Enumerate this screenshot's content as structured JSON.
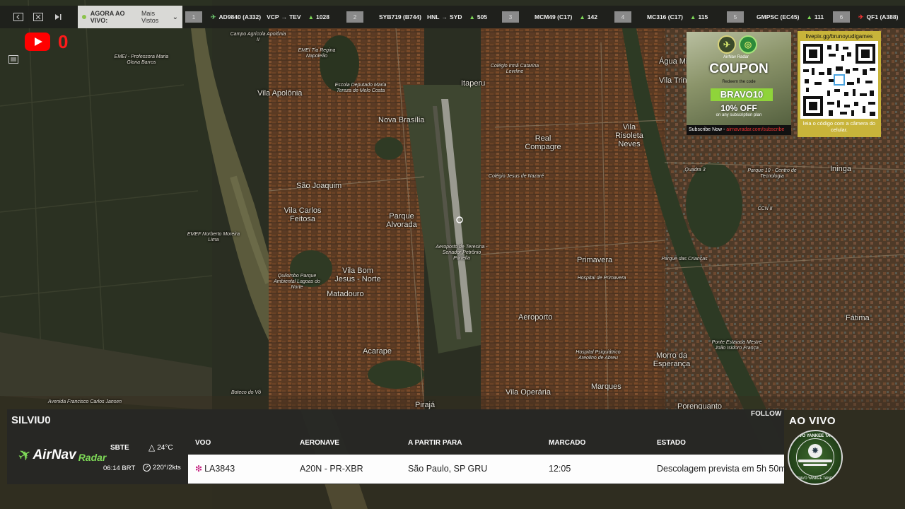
{
  "topbar": {
    "live_label": "AGORA AO VIVO: ",
    "live_value": "Mais Vistos",
    "slots": [
      {
        "num": "1",
        "flight": "AD9840 (A332)",
        "from": "VCP",
        "to": "TEV",
        "alt": "1028",
        "plane_color": "green"
      },
      {
        "num": "2",
        "flight": "SYB719 (B744)",
        "from": "HNL",
        "to": "SYD",
        "alt": "505",
        "plane_color": "none"
      },
      {
        "num": "3",
        "flight": "MCM49 (C17)",
        "from": "",
        "to": "",
        "alt": "142",
        "plane_color": "none"
      },
      {
        "num": "4",
        "flight": "MC316 (C17)",
        "from": "",
        "to": "",
        "alt": "115",
        "plane_color": "none"
      },
      {
        "num": "5",
        "flight": "GMPSC (EC45)",
        "from": "",
        "to": "",
        "alt": "111",
        "plane_color": "none"
      },
      {
        "num": "6",
        "flight": "QF1 (A388)",
        "from": "",
        "to": "",
        "alt": "",
        "plane_color": "red"
      }
    ]
  },
  "youtube": {
    "count": "0"
  },
  "map_labels": {
    "vila_apolonia": "Vila Apolônia",
    "nova_brasilia": "Nova Brasília",
    "itaperu": "Itaperu",
    "vila_trindade": "Vila Trindade",
    "vila_risoleta": "Vila Risoleta Neves",
    "real_compagre": "Real Compagre",
    "sao_joaquim": "São Joaquim",
    "vila_carlos_feitosa": "Vila Carlos Feitosa",
    "parque_alvorada": "Parque Alvorada",
    "vila_bom_jesus": "Vila Bom Jesus - Norte",
    "matadouro": "Matadouro",
    "acarape": "Acarape",
    "primavera": "Primavera",
    "aeroporto": "Aeroporto",
    "morro_esperanca": "Morro da Esperança",
    "marques": "Marques",
    "vila_operaria": "Vila Operária",
    "piraja": "Pirajá",
    "aguas_mineral": "Água Mineral",
    "fatima": "Fátima",
    "ininga": "Ininga",
    "porenquanto": "Porenquanto",
    "cond_apolonia": "Campo Agrícola Apolônia II",
    "emei_prof": "EMEI - Professora Maria Gloria Barros",
    "emef_norberto": "EMEF Norberto Moreira Lima",
    "emei_tia": "EMEI Tia Regina Napoleão",
    "emef_dep": "Escola Deputado Maria Tereza de Melo Costa",
    "aeroporto_terminal": "Aeroporto de Teresina - Senador Petrônio Portella",
    "colegio": "Colégio Irmã Catarina Levrline",
    "quadra": "Quadra 3",
    "parque10": "Parque 10 - Centro de Tecnologia",
    "cgn": "CCN II",
    "parque_criancas": "Parque das Crianças",
    "ponte": "Ponte Estaiada Mestre João Isidoro França",
    "hospital": "Hospital de Primavera",
    "hospital2": "Hospital Psiquiátrico Areolino de Abreu",
    "quilombo": "Quilombo Parque Ambiental Lagoas do Norte",
    "boteco": "Boteco do Vô",
    "avenida": "Avenida Francisco Carlos Jansen",
    "colegio2": "Colégio Jesus de Nazaré"
  },
  "coupon": {
    "brand": "AirNav Radar",
    "title": "COUPON",
    "sub": "Redeem the code",
    "code": "BRAVO10",
    "discount": "10% OFF",
    "note": "on any subscription plan",
    "footer_left": "Subscribe Now - ",
    "footer_right": "airnavradar.com/subscribe"
  },
  "qr": {
    "url": "livepix.gg/brunoyudigames",
    "caption": "leia o código com a câmera do celular."
  },
  "panel": {
    "callsign": "SILVIU0",
    "follow": "FOLLOW",
    "logo_air": "AirNav",
    "logo_radar": "Radar",
    "airport": "SBTE",
    "time": "06:14 BRT",
    "temp": "24°C",
    "wind": "220°/2kts",
    "headers": {
      "voo": "VOO",
      "aeronave": "AERONAVE",
      "partir": "A PARTIR PARA",
      "marcado": "MARCADO",
      "estado": "ESTADO"
    },
    "row": {
      "voo": "LA3843",
      "aeronave": "A20N - PR-XBR",
      "partir": "São Paulo, SP GRU",
      "marcado": "12:05",
      "estado": "Descolagem prevista em 5h 50m"
    }
  },
  "aovivo": {
    "label": "AO VIVO",
    "badge_top": "BRAVO YANKEE TANGO",
    "badge_bot": "BRAVO YANKEE TANGO"
  }
}
